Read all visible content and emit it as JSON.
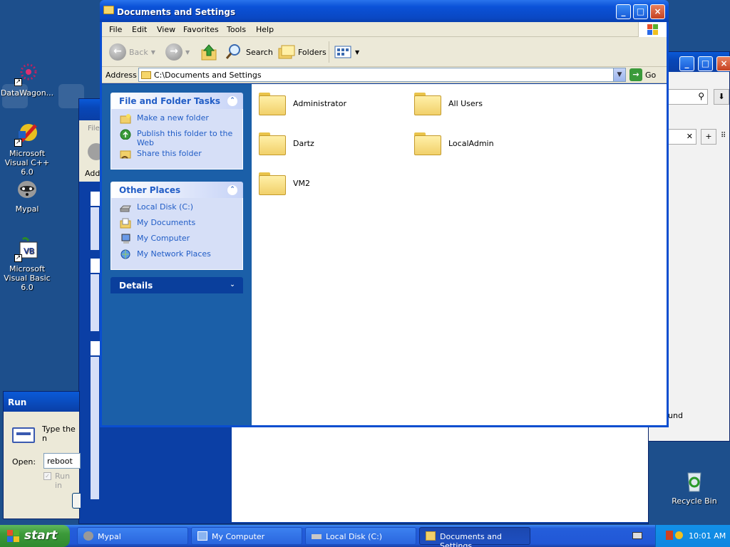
{
  "desktop": {
    "icons": [
      {
        "label": "DataWagon...",
        "icon": "datawagon-icon"
      },
      {
        "label": "Microsoft Visual C++ 6.0",
        "icon": "visual-cpp-icon"
      },
      {
        "label": "Mypal",
        "icon": "mypal-icon"
      },
      {
        "label": "Microsoft Visual Basic 6.0",
        "icon": "visual-basic-icon"
      },
      {
        "label": "Recycle Bin",
        "icon": "recycle-bin-icon"
      }
    ]
  },
  "explorer": {
    "title": "Documents and Settings",
    "menu": [
      "File",
      "Edit",
      "View",
      "Favorites",
      "Tools",
      "Help"
    ],
    "toolbar": {
      "back": "Back",
      "search": "Search",
      "folders": "Folders"
    },
    "address": {
      "label": "Address",
      "value": "C:\\Documents and Settings",
      "go": "Go"
    },
    "tasks_panel": {
      "title": "File and Folder Tasks",
      "items": [
        "Make a new folder",
        "Publish this folder to the Web",
        "Share this folder"
      ]
    },
    "places_panel": {
      "title": "Other Places",
      "items": [
        "Local Disk (C:)",
        "My Documents",
        "My Computer",
        "My Network Places"
      ]
    },
    "details_panel": {
      "title": "Details"
    },
    "folders": [
      "Administrator",
      "All Users",
      "Dartz",
      "LocalAdmin",
      "VM2"
    ]
  },
  "background": {
    "right_window_text": "und",
    "left_window_fragments": [
      "File",
      "Add"
    ]
  },
  "run_dialog": {
    "title": "Run",
    "description": "Type the n Internet re",
    "open_label": "Open:",
    "open_value": "reboot",
    "run_in_label": "Run in"
  },
  "taskbar": {
    "start": "start",
    "buttons": [
      {
        "label": "Mypal",
        "active": false
      },
      {
        "label": "My Computer",
        "active": false
      },
      {
        "label": "Local Disk (C:)",
        "active": false
      },
      {
        "label": "Documents and Settings",
        "active": true
      }
    ],
    "clock": "10:01 AM"
  }
}
